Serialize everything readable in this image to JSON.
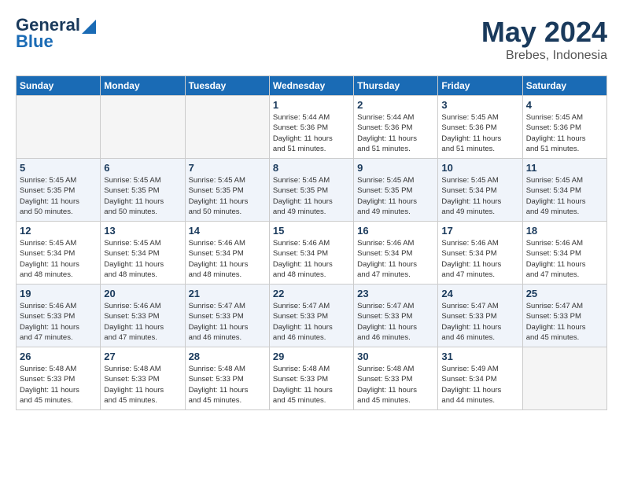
{
  "header": {
    "logo_line1": "General",
    "logo_line2": "Blue",
    "month": "May 2024",
    "location": "Brebes, Indonesia"
  },
  "weekdays": [
    "Sunday",
    "Monday",
    "Tuesday",
    "Wednesday",
    "Thursday",
    "Friday",
    "Saturday"
  ],
  "weeks": [
    [
      {
        "day": "",
        "info": ""
      },
      {
        "day": "",
        "info": ""
      },
      {
        "day": "",
        "info": ""
      },
      {
        "day": "1",
        "info": "Sunrise: 5:44 AM\nSunset: 5:36 PM\nDaylight: 11 hours\nand 51 minutes."
      },
      {
        "day": "2",
        "info": "Sunrise: 5:44 AM\nSunset: 5:36 PM\nDaylight: 11 hours\nand 51 minutes."
      },
      {
        "day": "3",
        "info": "Sunrise: 5:45 AM\nSunset: 5:36 PM\nDaylight: 11 hours\nand 51 minutes."
      },
      {
        "day": "4",
        "info": "Sunrise: 5:45 AM\nSunset: 5:36 PM\nDaylight: 11 hours\nand 51 minutes."
      }
    ],
    [
      {
        "day": "5",
        "info": "Sunrise: 5:45 AM\nSunset: 5:35 PM\nDaylight: 11 hours\nand 50 minutes."
      },
      {
        "day": "6",
        "info": "Sunrise: 5:45 AM\nSunset: 5:35 PM\nDaylight: 11 hours\nand 50 minutes."
      },
      {
        "day": "7",
        "info": "Sunrise: 5:45 AM\nSunset: 5:35 PM\nDaylight: 11 hours\nand 50 minutes."
      },
      {
        "day": "8",
        "info": "Sunrise: 5:45 AM\nSunset: 5:35 PM\nDaylight: 11 hours\nand 49 minutes."
      },
      {
        "day": "9",
        "info": "Sunrise: 5:45 AM\nSunset: 5:35 PM\nDaylight: 11 hours\nand 49 minutes."
      },
      {
        "day": "10",
        "info": "Sunrise: 5:45 AM\nSunset: 5:34 PM\nDaylight: 11 hours\nand 49 minutes."
      },
      {
        "day": "11",
        "info": "Sunrise: 5:45 AM\nSunset: 5:34 PM\nDaylight: 11 hours\nand 49 minutes."
      }
    ],
    [
      {
        "day": "12",
        "info": "Sunrise: 5:45 AM\nSunset: 5:34 PM\nDaylight: 11 hours\nand 48 minutes."
      },
      {
        "day": "13",
        "info": "Sunrise: 5:45 AM\nSunset: 5:34 PM\nDaylight: 11 hours\nand 48 minutes."
      },
      {
        "day": "14",
        "info": "Sunrise: 5:46 AM\nSunset: 5:34 PM\nDaylight: 11 hours\nand 48 minutes."
      },
      {
        "day": "15",
        "info": "Sunrise: 5:46 AM\nSunset: 5:34 PM\nDaylight: 11 hours\nand 48 minutes."
      },
      {
        "day": "16",
        "info": "Sunrise: 5:46 AM\nSunset: 5:34 PM\nDaylight: 11 hours\nand 47 minutes."
      },
      {
        "day": "17",
        "info": "Sunrise: 5:46 AM\nSunset: 5:34 PM\nDaylight: 11 hours\nand 47 minutes."
      },
      {
        "day": "18",
        "info": "Sunrise: 5:46 AM\nSunset: 5:34 PM\nDaylight: 11 hours\nand 47 minutes."
      }
    ],
    [
      {
        "day": "19",
        "info": "Sunrise: 5:46 AM\nSunset: 5:33 PM\nDaylight: 11 hours\nand 47 minutes."
      },
      {
        "day": "20",
        "info": "Sunrise: 5:46 AM\nSunset: 5:33 PM\nDaylight: 11 hours\nand 47 minutes."
      },
      {
        "day": "21",
        "info": "Sunrise: 5:47 AM\nSunset: 5:33 PM\nDaylight: 11 hours\nand 46 minutes."
      },
      {
        "day": "22",
        "info": "Sunrise: 5:47 AM\nSunset: 5:33 PM\nDaylight: 11 hours\nand 46 minutes."
      },
      {
        "day": "23",
        "info": "Sunrise: 5:47 AM\nSunset: 5:33 PM\nDaylight: 11 hours\nand 46 minutes."
      },
      {
        "day": "24",
        "info": "Sunrise: 5:47 AM\nSunset: 5:33 PM\nDaylight: 11 hours\nand 46 minutes."
      },
      {
        "day": "25",
        "info": "Sunrise: 5:47 AM\nSunset: 5:33 PM\nDaylight: 11 hours\nand 45 minutes."
      }
    ],
    [
      {
        "day": "26",
        "info": "Sunrise: 5:48 AM\nSunset: 5:33 PM\nDaylight: 11 hours\nand 45 minutes."
      },
      {
        "day": "27",
        "info": "Sunrise: 5:48 AM\nSunset: 5:33 PM\nDaylight: 11 hours\nand 45 minutes."
      },
      {
        "day": "28",
        "info": "Sunrise: 5:48 AM\nSunset: 5:33 PM\nDaylight: 11 hours\nand 45 minutes."
      },
      {
        "day": "29",
        "info": "Sunrise: 5:48 AM\nSunset: 5:33 PM\nDaylight: 11 hours\nand 45 minutes."
      },
      {
        "day": "30",
        "info": "Sunrise: 5:48 AM\nSunset: 5:33 PM\nDaylight: 11 hours\nand 45 minutes."
      },
      {
        "day": "31",
        "info": "Sunrise: 5:49 AM\nSunset: 5:34 PM\nDaylight: 11 hours\nand 44 minutes."
      },
      {
        "day": "",
        "info": ""
      }
    ]
  ]
}
